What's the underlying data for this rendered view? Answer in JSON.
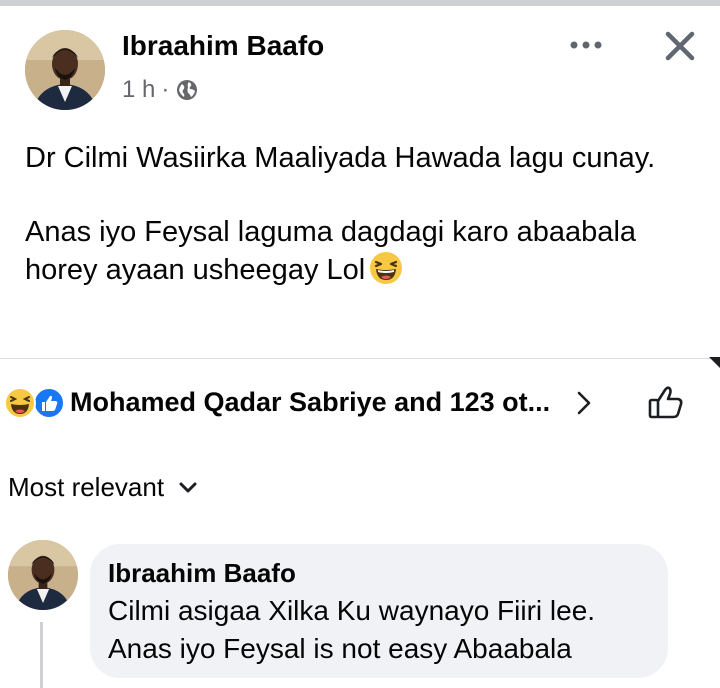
{
  "post": {
    "author": "Ibraahim Baafo",
    "time": "1 h",
    "separator": "·",
    "privacy_icon": "globe-icon",
    "text_lines": [
      "Dr Cilmi Wasiirka Maaliyada Hawada lagu cunay.",
      "Anas iyo Feysal laguma dagdagi karo abaabala horey ayaan usheegay Lol"
    ],
    "more_icon": "more-dots-icon",
    "close_icon": "close-icon"
  },
  "reactions": {
    "icons": [
      "haha-icon",
      "like-icon"
    ],
    "summary": "Mohamed Qadar Sabriye and 123 ot...",
    "like_icon": "thumbs-up-outline-icon"
  },
  "comments": {
    "filter_label": "Most relevant",
    "items": [
      {
        "author": "Ibraahim Baafo",
        "text_line1": "Cilmi asigaa Xilka Ku waynayo Fiiri lee.",
        "text_line2": "Anas iyo Feysal is not easy Abaabala"
      }
    ]
  },
  "colors": {
    "text": "#050505",
    "secondary_text": "#65676b",
    "bubble": "#f0f2f5",
    "like_blue": "#1877f2",
    "haha_yellow": "#f7c843",
    "divider": "#dadde1"
  }
}
